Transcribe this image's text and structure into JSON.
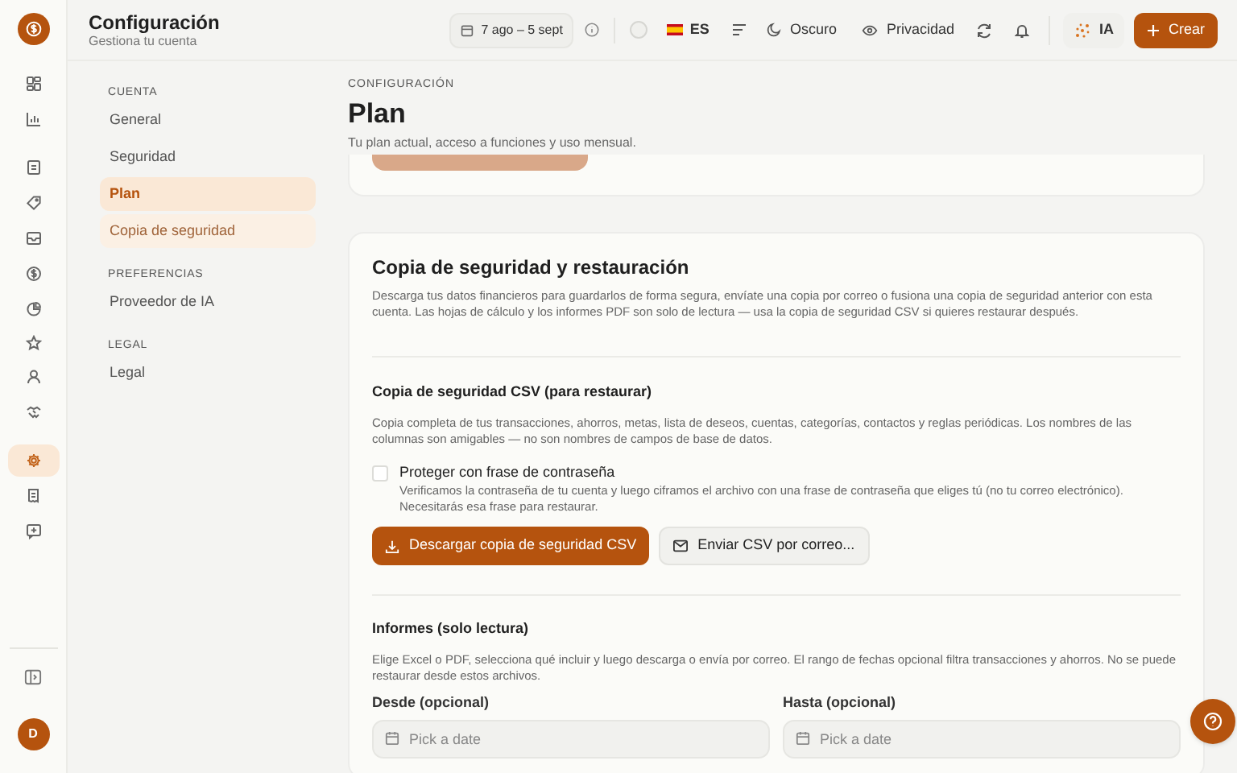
{
  "rail": {
    "items": [
      {
        "selected": false
      },
      {
        "selected": false
      },
      {
        "selected": false
      },
      {
        "selected": false
      },
      {
        "selected": false
      },
      {
        "selected": false
      },
      {
        "selected": false
      },
      {
        "selected": false
      },
      {
        "selected": false
      },
      {
        "selected": false
      },
      {
        "selected": true
      },
      {
        "selected": false
      },
      {
        "selected": false
      }
    ],
    "avatar": "D"
  },
  "header": {
    "title": "Configuración",
    "subtitle": "Gestiona tu cuenta",
    "date_range": "7 ago – 5 sept",
    "language": "ES",
    "theme": "Oscuro",
    "privacy": "Privacidad",
    "ai": "IA",
    "create": "Crear"
  },
  "settings_nav": [
    {
      "heading": "CUENTA",
      "items": [
        {
          "label": "General",
          "selected": false,
          "hover": false
        },
        {
          "label": "Seguridad",
          "selected": false,
          "hover": false
        },
        {
          "label": "Plan",
          "selected": true,
          "hover": false
        },
        {
          "label": "Copia de seguridad",
          "selected": false,
          "hover": true
        }
      ]
    },
    {
      "heading": "PREFERENCIAS",
      "items": [
        {
          "label": "Proveedor de IA",
          "selected": false,
          "hover": false
        }
      ]
    },
    {
      "heading": "LEGAL",
      "items": [
        {
          "label": "Legal",
          "selected": false,
          "hover": false
        }
      ]
    }
  ],
  "page": {
    "eyebrow": "CONFIGURACIÓN",
    "title": "Plan",
    "subtitle": "Tu plan actual, acceso a funciones y uso mensual."
  },
  "backup_card": {
    "title": "Copia de seguridad y restauración",
    "description": "Descarga tus datos financieros para guardarlos de forma segura, envíate una copia por correo o fusiona una copia de seguridad anterior con esta cuenta. Las hojas de cálculo y los informes PDF son solo de lectura — usa la copia de seguridad CSV si quieres restaurar después.",
    "csv": {
      "title": "Copia de seguridad CSV (para restaurar)",
      "description": "Copia completa de tus transacciones, ahorros, metas, lista de deseos, cuentas, categorías, contactos y reglas periódicas. Los nombres de las columnas son amigables — no son nombres de campos de base de datos.",
      "passphrase": {
        "label": "Proteger con frase de contraseña",
        "checked": false,
        "help": "Verificamos la contraseña de tu cuenta y luego ciframos el archivo con una frase de contraseña que eliges tú (no tu correo electrónico). Necesitarás esa frase para restaurar."
      },
      "download": "Descargar copia de seguridad CSV",
      "email": "Enviar CSV por correo..."
    },
    "reports": {
      "title": "Informes (solo lectura)",
      "description": "Elige Excel o PDF, selecciona qué incluir y luego descarga o envía por correo. El rango de fechas opcional filtra transacciones y ahorros. No se puede restaurar desde estos archivos.",
      "fields": [
        {
          "label": "Desde (opcional)",
          "placeholder": "Pick a date"
        },
        {
          "label": "Hasta (opcional)",
          "placeholder": "Pick a date"
        }
      ]
    }
  }
}
